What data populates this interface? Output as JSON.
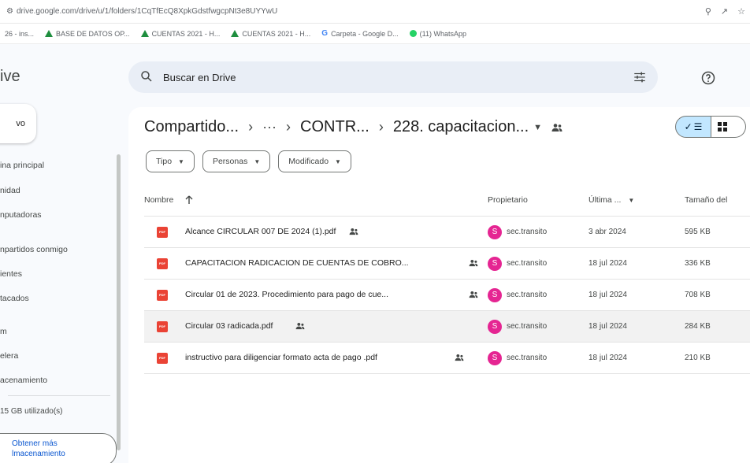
{
  "browser": {
    "url": "drive.google.com/drive/u/1/folders/1CqTfEcQ8XpkGdstfwgcpNt3e8UYYwU",
    "bookmarks": [
      {
        "label": "26 - ins...",
        "icon": "none"
      },
      {
        "label": "BASE DE DATOS OP...",
        "icon": "drive-icon"
      },
      {
        "label": "CUENTAS 2021 - H...",
        "icon": "drive-icon"
      },
      {
        "label": "CUENTAS 2021 - H...",
        "icon": "drive-icon"
      },
      {
        "label": "Carpeta - Google D...",
        "icon": "google-icon"
      },
      {
        "label": "(11) WhatsApp",
        "icon": "whatsapp-icon"
      }
    ]
  },
  "app": {
    "brand_partial": "ive",
    "search_placeholder": "Buscar en Drive"
  },
  "sidebar": {
    "new_label": "vo",
    "items": [
      {
        "label": "ina principal"
      },
      {
        "label": "nidad"
      },
      {
        "label": "nputadoras"
      },
      {
        "label": "npartidos conmigo"
      },
      {
        "label": "ientes"
      },
      {
        "label": "tacados"
      },
      {
        "label": "m"
      },
      {
        "label": "elera"
      },
      {
        "label": "acenamiento"
      }
    ],
    "storage_text": "15 GB utilizado(s)",
    "storage_button_line1": "Obtener más",
    "storage_button_line2": "lmacenamiento"
  },
  "breadcrumb": {
    "root": "Compartido...",
    "more": "···",
    "middle": "CONTR...",
    "current": "228. capacitacion..."
  },
  "filters": [
    {
      "label": "Tipo"
    },
    {
      "label": "Personas"
    },
    {
      "label": "Modificado"
    }
  ],
  "columns": {
    "name": "Nombre",
    "owner": "Propietario",
    "modified": "Última ...",
    "size": "Tamaño del"
  },
  "files": [
    {
      "name": "Alcance CIRCULAR 007 DE 2024 (1).pdf",
      "owner_initial": "S",
      "owner": "sec.transito",
      "date": "3 abr 2024",
      "size": "595 KB",
      "selected": false
    },
    {
      "name": "CAPACITACION RADICACION DE CUENTAS DE COBRO...",
      "owner_initial": "S",
      "owner": "sec.transito",
      "date": "18 jul 2024",
      "size": "336 KB",
      "selected": false
    },
    {
      "name": "Circular 01 de 2023. Procedimiento para pago de cue...",
      "owner_initial": "S",
      "owner": "sec.transito",
      "date": "18 jul 2024",
      "size": "708 KB",
      "selected": false
    },
    {
      "name": "Circular 03 radicada.pdf",
      "owner_initial": "S",
      "owner": "sec.transito",
      "date": "18 jul 2024",
      "size": "284 KB",
      "selected": true
    },
    {
      "name": "instructivo para diligenciar formato acta de pago .pdf",
      "owner_initial": "S",
      "owner": "sec.transito",
      "date": "18 jul 2024",
      "size": "210 KB",
      "selected": false
    }
  ],
  "colors": {
    "accent": "#0b57d0",
    "selected_view": "#c2e7ff",
    "pdf_red": "#ea4335",
    "avatar_pink": "#e52592"
  }
}
